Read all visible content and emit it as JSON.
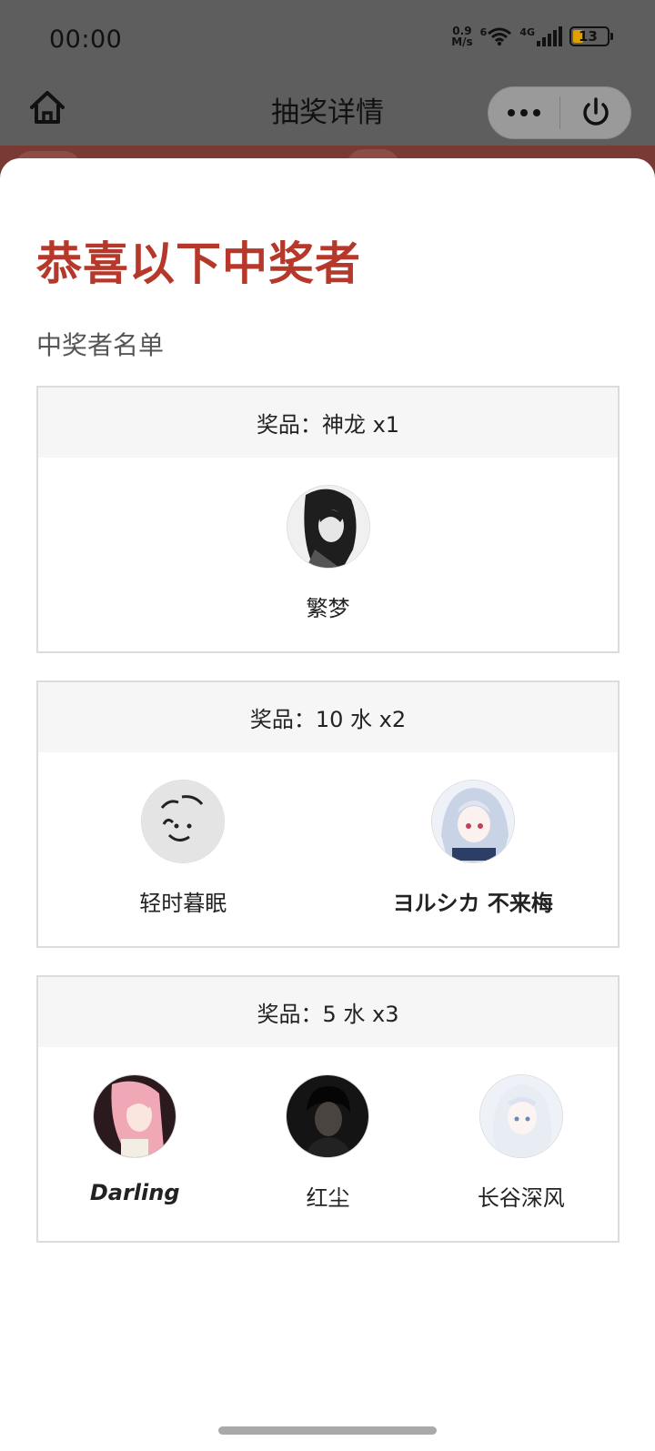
{
  "status": {
    "time": "00:00",
    "net_speed_top": "0.9",
    "net_speed_bottom": "M/s",
    "wifi_badge": "6",
    "cell_badge": "4G",
    "battery": "13"
  },
  "nav": {
    "title": "抽奖详情"
  },
  "sheet": {
    "headline": "恭喜以下中奖者",
    "subhead": "中奖者名单"
  },
  "prizes": [
    {
      "label": "奖品：神龙 x1",
      "winners": [
        {
          "name": "繁梦"
        }
      ]
    },
    {
      "label": "奖品：10 水 x2",
      "winners": [
        {
          "name": "轻时暮眠"
        },
        {
          "name": "ヨルシカ 不来梅"
        }
      ]
    },
    {
      "label": "奖品：5 水 x3",
      "winners": [
        {
          "name": "Darling"
        },
        {
          "name": "红尘"
        },
        {
          "name": "长谷深风"
        }
      ]
    }
  ],
  "colors": {
    "headline": "#b5382b",
    "battery_fill": "#e0a000"
  },
  "icons": {
    "home": "home-icon",
    "more": "more-dots-icon",
    "power": "power-icon"
  }
}
